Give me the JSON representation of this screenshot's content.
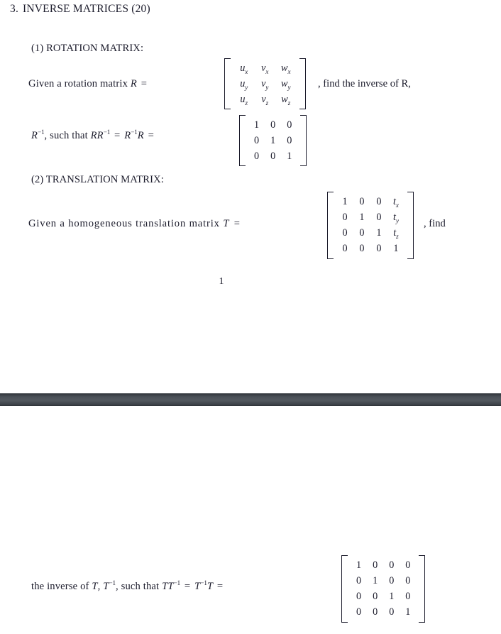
{
  "document": {
    "problem_number": "3.",
    "title": "INVERSE MATRICES (20)",
    "page_number": "1"
  },
  "section_rotation": {
    "heading": "(1) ROTATION MATRIX:",
    "prompt_before": "Given a rotation matrix",
    "prompt_symbol": "R",
    "equals": "=",
    "prompt_after": ", find the inverse of R,",
    "identity_line_prefix": "such that",
    "matrix_R": {
      "rows": 3,
      "cols": 3,
      "cells": [
        [
          "u",
          "v",
          "w"
        ],
        [
          "u",
          "v",
          "w"
        ],
        [
          "u",
          "v",
          "w"
        ]
      ],
      "subscripts": [
        [
          "x",
          "x",
          "x"
        ],
        [
          "y",
          "y",
          "y"
        ],
        [
          "z",
          "z",
          "z"
        ]
      ]
    },
    "matrix_identity3": {
      "rows": 3,
      "cols": 3,
      "cells": [
        [
          "1",
          "0",
          "0"
        ],
        [
          "0",
          "1",
          "0"
        ],
        [
          "0",
          "0",
          "1"
        ]
      ]
    }
  },
  "section_translation": {
    "heading": "(2) TRANSLATION MATRIX:",
    "prompt_before": "Given a homogeneous translation matrix",
    "prompt_symbol": "T",
    "equals": "=",
    "prompt_after": ", find",
    "matrix_T": {
      "rows": 4,
      "cols": 4,
      "cells": [
        [
          "1",
          "0",
          "0",
          "t"
        ],
        [
          "0",
          "1",
          "0",
          "t"
        ],
        [
          "0",
          "0",
          "1",
          "t"
        ],
        [
          "0",
          "0",
          "0",
          "1"
        ]
      ],
      "subscripts": [
        [
          "",
          "",
          "",
          "x"
        ],
        [
          "",
          "",
          "",
          "y"
        ],
        [
          "",
          "",
          "",
          "z"
        ],
        [
          "",
          "",
          "",
          ""
        ]
      ]
    },
    "matrix_identity4": {
      "rows": 4,
      "cols": 4,
      "cells": [
        [
          "1",
          "0",
          "0",
          "0"
        ],
        [
          "0",
          "1",
          "0",
          "0"
        ],
        [
          "0",
          "0",
          "1",
          "0"
        ],
        [
          "0",
          "0",
          "0",
          "1"
        ]
      ]
    },
    "continuation_text": "the inverse of T, T−1, such that TT−1 = T−1T ="
  },
  "colors": {
    "text": "#1b1b2b",
    "page_background": "#ffffff",
    "separator_dark": "#2f343a",
    "separator_light": "#53595f"
  }
}
